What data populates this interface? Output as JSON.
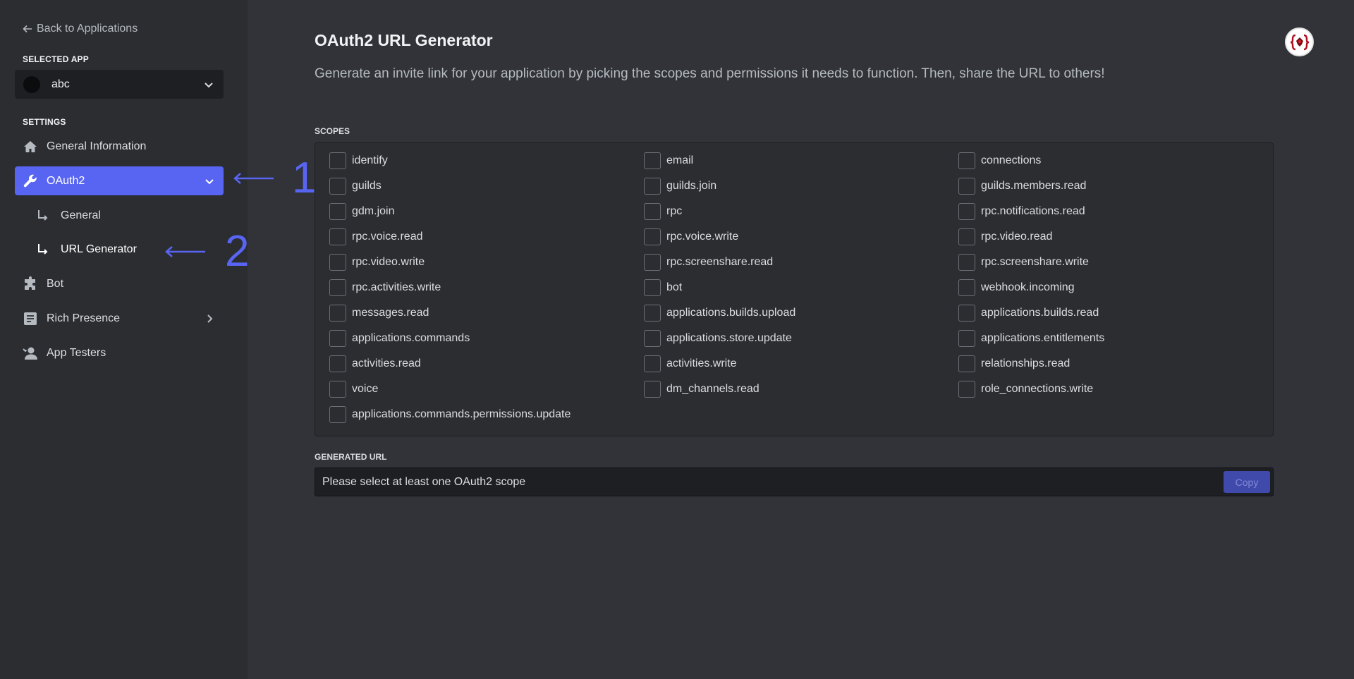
{
  "sidebar": {
    "back_label": "Back to Applications",
    "selected_app_heading": "SELECTED APP",
    "selected_app_name": "abc",
    "settings_heading": "SETTINGS",
    "items": [
      {
        "label": "General Information",
        "icon": "home-icon"
      },
      {
        "label": "OAuth2",
        "icon": "wrench-icon",
        "active": true
      },
      {
        "label": "Bot",
        "icon": "puzzle-icon"
      },
      {
        "label": "Rich Presence",
        "icon": "document-icon"
      },
      {
        "label": "App Testers",
        "icon": "person-icon"
      }
    ],
    "sub_items": [
      {
        "label": "General"
      },
      {
        "label": "URL Generator",
        "active": true
      }
    ]
  },
  "annotations": [
    {
      "label": "1"
    },
    {
      "label": "2"
    }
  ],
  "main": {
    "title": "OAuth2 URL Generator",
    "description": "Generate an invite link for your application by picking the scopes and permissions it needs to function. Then, share the URL to others!",
    "scopes_heading": "SCOPES",
    "scopes": [
      "identify",
      "email",
      "connections",
      "guilds",
      "guilds.join",
      "guilds.members.read",
      "gdm.join",
      "rpc",
      "rpc.notifications.read",
      "rpc.voice.read",
      "rpc.voice.write",
      "rpc.video.read",
      "rpc.video.write",
      "rpc.screenshare.read",
      "rpc.screenshare.write",
      "rpc.activities.write",
      "bot",
      "webhook.incoming",
      "messages.read",
      "applications.builds.upload",
      "applications.builds.read",
      "applications.commands",
      "applications.store.update",
      "applications.entitlements",
      "activities.read",
      "activities.write",
      "relationships.read",
      "voice",
      "dm_channels.read",
      "role_connections.write",
      "applications.commands.permissions.update"
    ],
    "generated_url_heading": "GENERATED URL",
    "generated_url_value": "Please select at least one OAuth2 scope",
    "copy_label": "Copy"
  },
  "colors": {
    "accent": "#5865f2",
    "background": "#313338",
    "sidebar": "#2b2d31"
  }
}
